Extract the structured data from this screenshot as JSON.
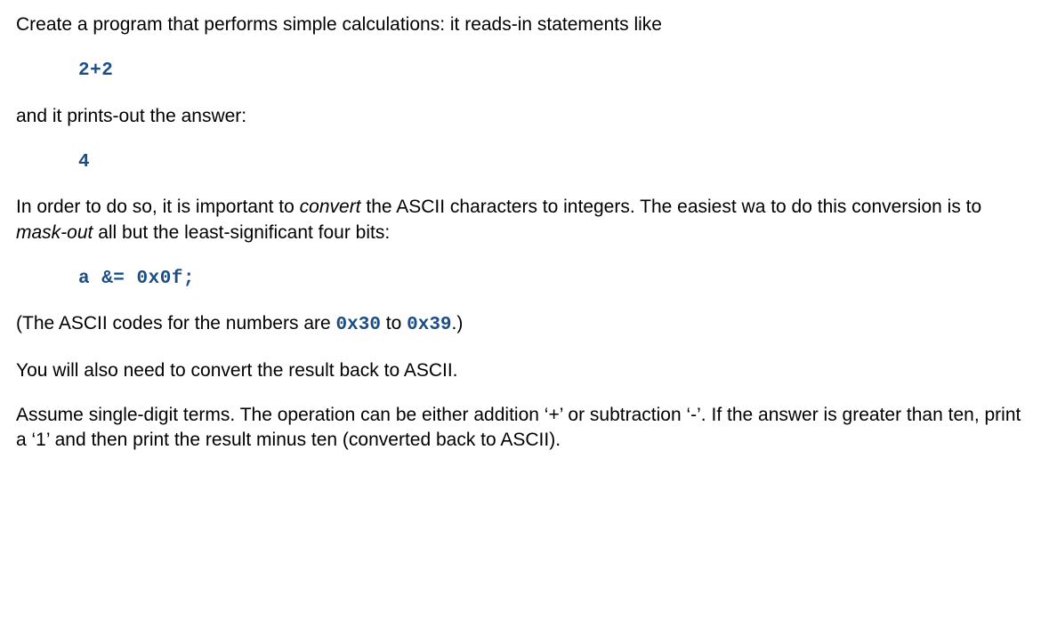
{
  "para1": "Create a program that performs simple calculations: it reads-in statements like",
  "example1": "2+2",
  "para2": "and it prints-out the answer:",
  "example2": "4",
  "para3a": "In order to do so, it is important to ",
  "para3i1": "convert",
  "para3b": " the ASCII characters to integers.  The easiest wa to do this conversion is to ",
  "para3i2": "mask-out",
  "para3c": " all but the least-significant four bits:",
  "example3": "a  &=  0x0f;",
  "para4a": "(The ASCII codes for the numbers are ",
  "code1": "0x30",
  "para4b": " to ",
  "code2": "0x39",
  "para4c": ".)",
  "para5": "You will also need to convert the result back to ASCII.",
  "para6": "Assume single-digit terms.  The operation can be either addition ‘+’ or subtraction ‘-’.  If the answer is greater than ten, print a ‘1’ and then print the result minus ten (converted back to ASCII)."
}
